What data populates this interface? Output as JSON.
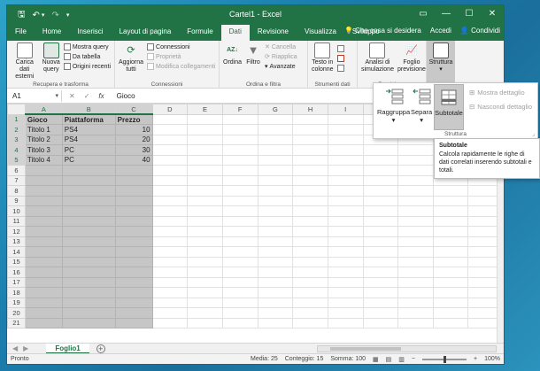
{
  "titlebar": {
    "title": "Cartel1 - Excel",
    "qat": {
      "save": "🖫",
      "undo": "↶",
      "undo_more": "▾",
      "redo": "↷",
      "customize": "▾"
    },
    "controls": {
      "restore": "▭",
      "minimize": "—",
      "maximize": "☐",
      "close": "✕"
    }
  },
  "tabs": [
    {
      "label": "File"
    },
    {
      "label": "Home"
    },
    {
      "label": "Inserisci"
    },
    {
      "label": "Layout di pagina"
    },
    {
      "label": "Formule"
    },
    {
      "label": "Dati"
    },
    {
      "label": "Revisione"
    },
    {
      "label": "Visualizza"
    },
    {
      "label": "Sviluppo"
    }
  ],
  "tell_me": "Che cosa si desidera",
  "account": {
    "signin": "Accedi",
    "share": "Condividi"
  },
  "ribbon": {
    "recupera": {
      "carica": "Carica dati\nesterni",
      "nuova": "Nuova\nquery",
      "mostra": "Mostra query",
      "tabella": "Da tabella",
      "origini": "Origini recenti",
      "label": "Recupera e trasforma"
    },
    "connessioni": {
      "aggiorna": "Aggiorna\ntutti",
      "conn": "Connessioni",
      "proprieta": "Proprietà",
      "modifica": "Modifica collegamenti",
      "label": "Connessioni"
    },
    "ordina": {
      "ordina": "Ordina",
      "filtro": "Filtro",
      "cancella": "Cancella",
      "riapplica": "Riapplica",
      "avanzate": "Avanzate",
      "label": "Ordina e filtra"
    },
    "strumenti": {
      "testo": "Testo in\ncolonne",
      "label": "Strumenti dati"
    },
    "previsione": {
      "analisi": "Analisi di\nsimulazione",
      "foglio": "Foglio\nprevisione",
      "label": "Previsione"
    },
    "struttura": {
      "label": "Struttura"
    }
  },
  "formula_bar": {
    "cell_ref": "A1",
    "value": "Gioco",
    "cancel": "✕",
    "enter": "✓",
    "fx": "fx"
  },
  "columns": [
    "A",
    "B",
    "C",
    "D",
    "E",
    "F",
    "G",
    "H",
    "I"
  ],
  "rows": [
    [
      "Gioco",
      "Piattaforma",
      "Prezzo"
    ],
    [
      "Titolo 1",
      "PS4",
      "10"
    ],
    [
      "Titolo 2",
      "PS4",
      "20"
    ],
    [
      "Titolo 3",
      "PC",
      "30"
    ],
    [
      "Titolo 4",
      "PC",
      "40"
    ]
  ],
  "row_count": 21,
  "dropdown": {
    "raggruppa": "Raggruppa",
    "separa": "Separa",
    "subtotale": "Subtotale",
    "mostra": "Mostra dettaglio",
    "nascondi": "Nascondi dettaglio",
    "label": "Struttura"
  },
  "tooltip": {
    "title": "Subtotale",
    "body": "Calcola rapidamente le righe di dati correlati inserendo subtotali e totali."
  },
  "sheet": {
    "name": "Foglio1",
    "add": "+",
    "prev": "◀",
    "next": "▶"
  },
  "status": {
    "ready": "Pronto",
    "media": "Media: 25",
    "conteggio": "Conteggio: 15",
    "somma": "Somma: 100",
    "zoom": "100%",
    "zoom_out": "−",
    "zoom_in": "+"
  },
  "colors": {
    "brand": "#217346",
    "selection": "#c6c6c6"
  }
}
